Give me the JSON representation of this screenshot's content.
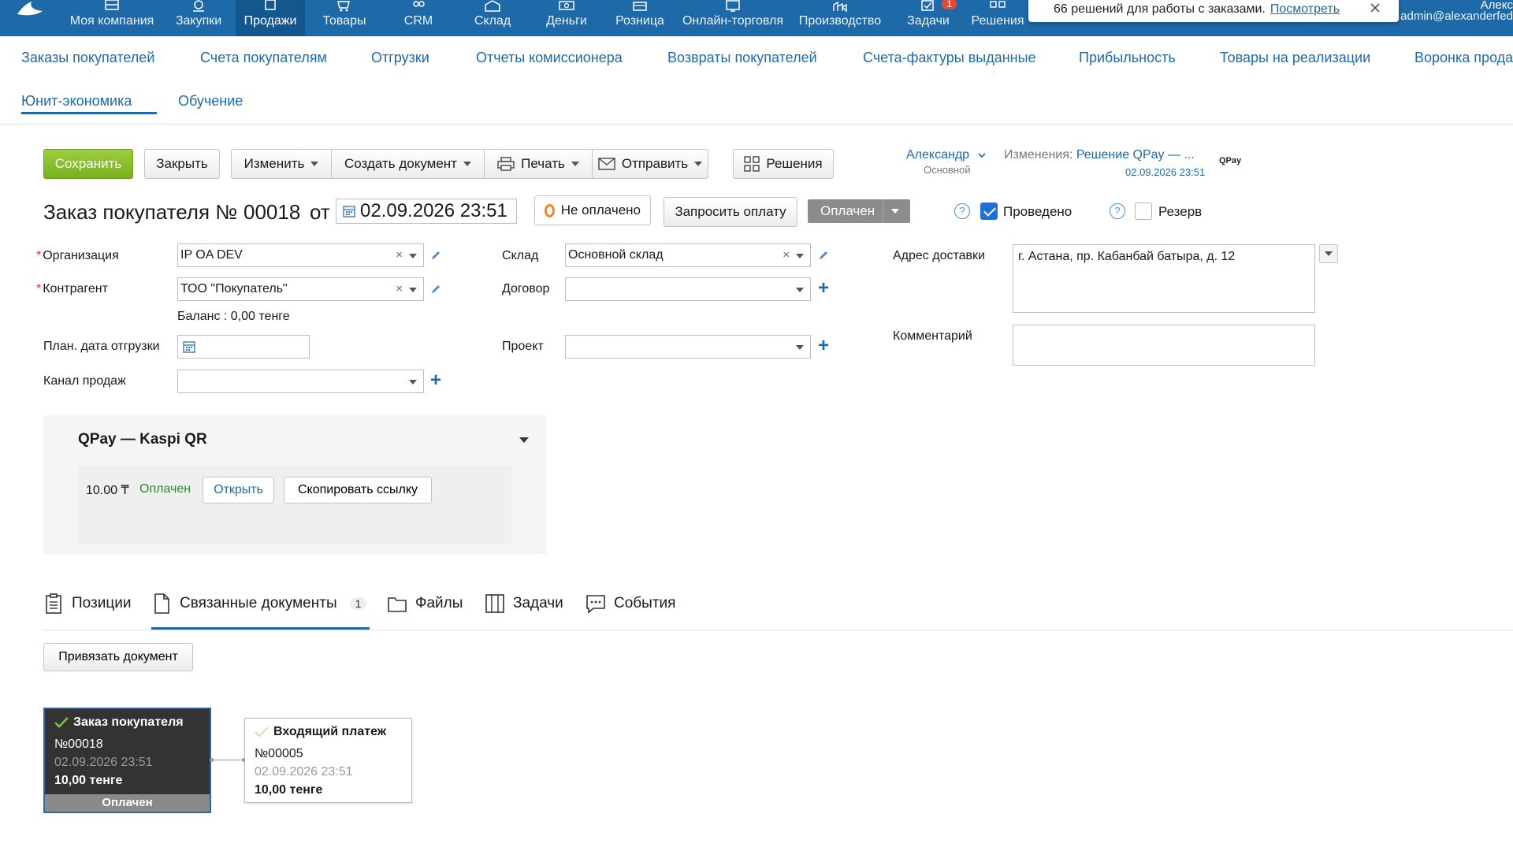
{
  "topnav": {
    "items": [
      {
        "label": "Моя компания",
        "icon": "company-icon"
      },
      {
        "label": "Закупки",
        "icon": "purchases-icon"
      },
      {
        "label": "Продажи",
        "icon": "sales-icon",
        "active": true
      },
      {
        "label": "Товары",
        "icon": "goods-icon"
      },
      {
        "label": "CRM",
        "icon": "crm-icon"
      },
      {
        "label": "Склад",
        "icon": "warehouse-icon"
      },
      {
        "label": "Деньги",
        "icon": "money-icon"
      },
      {
        "label": "Розница",
        "icon": "retail-icon"
      },
      {
        "label": "Онлайн-торговля",
        "icon": "online-trade-icon"
      },
      {
        "label": "Производство",
        "icon": "production-icon"
      },
      {
        "label": "Задачи",
        "icon": "tasks-icon",
        "badge": "1"
      },
      {
        "label": "Решения",
        "icon": "solutions-icon"
      }
    ],
    "notification": {
      "text": "66 решений для работы с заказами.",
      "link": "Посмотреть"
    },
    "user_name": "Алекс",
    "user_email": "admin@alexanderfed"
  },
  "subnav": {
    "tabs": [
      "Заказы покупателей",
      "Счета покупателям",
      "Отгрузки",
      "Отчеты комиссионера",
      "Возвраты покупателей",
      "Счета-фактуры выданные",
      "Прибыльность",
      "Товары на реализации",
      "Воронка прода",
      "Юнит-экономика",
      "Обучение"
    ]
  },
  "toolbar": {
    "save": "Сохранить",
    "close": "Закрыть",
    "change": "Изменить",
    "create_doc": "Создать документ",
    "print": "Печать",
    "send": "Отправить",
    "solutions": "Решения",
    "owner": "Александр",
    "owner_sub": "Основной",
    "changes_label": "Изменения:",
    "changes_link": "Решение QPay — ...",
    "changes_date": "02.09.2026 23:51",
    "qpay_logo": "QPay"
  },
  "header": {
    "title": "Заказ покупателя №",
    "number": "00018",
    "from": "от",
    "date": "02.09.2026 23:51",
    "payment_status": "Не оплачено",
    "request_payment": "Запросить оплату",
    "state": "Оплачен",
    "posted_label": "Проведено",
    "posted": true,
    "reserve_label": "Резерв",
    "reserve": false,
    "help": "?"
  },
  "form": {
    "organization_label": "Организация",
    "organization": "IP OA DEV",
    "counterparty_label": "Контрагент",
    "counterparty": "ТОО \"Покупатель\"",
    "balance": "Баланс : 0,00 тенге",
    "ship_date_label": "План. дата отгрузки",
    "channel_label": "Канал продаж",
    "warehouse_label": "Склад",
    "warehouse": "Основной склад",
    "contract_label": "Договор",
    "project_label": "Проект",
    "address_label": "Адрес доставки",
    "address": "г. Астана, пр. Кабанбай батыра, д. 12",
    "comment_label": "Комментарий"
  },
  "qpay": {
    "title": "QPay — Kaspi QR",
    "amount": "10.00 ₸",
    "status": "Оплачен",
    "open": "Открыть",
    "copy_link": "Скопировать ссылку"
  },
  "tabs": {
    "positions": "Позиции",
    "related": "Связанные документы",
    "related_count": "1",
    "files": "Файлы",
    "tasks": "Задачи",
    "events": "События"
  },
  "related": {
    "bind_button": "Привязать документ",
    "main": {
      "title": "Заказ покупателя",
      "number": "№00018",
      "date": "02.09.2026 23:51",
      "sum": "10,00 тенге",
      "status": "Оплачен"
    },
    "payment": {
      "title": "Входящий платеж",
      "number": "№00005",
      "date": "02.09.2026 23:51",
      "sum": "10,00 тенге"
    }
  },
  "colors": {
    "primary": "#1e69a8",
    "save": "#8bbf2b",
    "paid_green": "#2e8b30",
    "unpaid_orange": "#f08a1e"
  }
}
